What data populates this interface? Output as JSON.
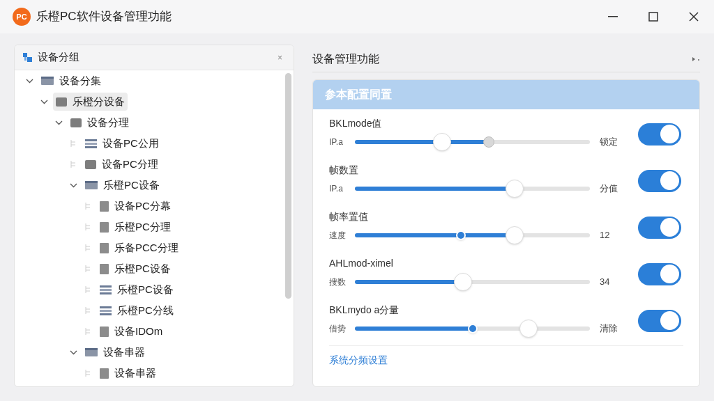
{
  "window": {
    "logo": "PC",
    "title": "乐橙PC软件设备管理功能"
  },
  "sidebar": {
    "title": "设备分组",
    "close": "×",
    "tree": [
      {
        "label": "设备分集",
        "kind": "bar",
        "expanded": true,
        "selected": false,
        "children": [
          {
            "label": "乐橙分设备",
            "kind": "box",
            "expanded": true,
            "selected": true,
            "children": [
              {
                "label": "设备分理",
                "kind": "box",
                "expanded": true,
                "selected": false,
                "children": [
                  {
                    "label": "设备PC公用",
                    "kind": "lines",
                    "selected": false
                  },
                  {
                    "label": "设备PC分理",
                    "kind": "box",
                    "selected": false
                  },
                  {
                    "label": "乐橙PC设备",
                    "kind": "bar",
                    "expanded": true,
                    "selected": false,
                    "children": [
                      {
                        "label": "设备PC分幕",
                        "kind": "book",
                        "selected": false
                      },
                      {
                        "label": "乐橙PC分理",
                        "kind": "book",
                        "selected": false
                      },
                      {
                        "label": "乐备PCC分理",
                        "kind": "book",
                        "selected": false
                      },
                      {
                        "label": "乐橙PC设备",
                        "kind": "book",
                        "selected": false
                      },
                      {
                        "label": "乐橙PC设备",
                        "kind": "lines",
                        "selected": false
                      },
                      {
                        "label": "乐橙PC分线",
                        "kind": "lines",
                        "selected": false
                      },
                      {
                        "label": "设备IDOm",
                        "kind": "book",
                        "selected": false
                      }
                    ]
                  },
                  {
                    "label": "设备串器",
                    "kind": "bar",
                    "expanded": true,
                    "selected": false,
                    "children": [
                      {
                        "label": "设备串器",
                        "kind": "book",
                        "selected": false
                      }
                    ]
                  }
                ]
              }
            ]
          }
        ]
      }
    ]
  },
  "panel": {
    "title": "设备管理功能",
    "section": "参本配置同置",
    "rows": [
      {
        "label": "BKLmode值",
        "sublabel": "IP.a",
        "level": 0.57,
        "handles": [
          {
            "kind": "large",
            "level": 0.37
          },
          {
            "kind": "small",
            "level": 0.57
          }
        ],
        "reading": "锁定",
        "on": true
      },
      {
        "label": "帧数置",
        "sublabel": "IP.a",
        "level": 0.68,
        "handles": [
          {
            "kind": "large",
            "level": 0.68
          }
        ],
        "reading": "分值",
        "on": true
      },
      {
        "label": "帧率置值",
        "sublabel": "速度",
        "level": 0.68,
        "handles": [
          {
            "kind": "dot",
            "level": 0.45
          },
          {
            "kind": "large",
            "level": 0.68
          }
        ],
        "reading": "12",
        "on": true
      },
      {
        "label": "AHLmod-ximel",
        "sublabel": "搜数",
        "level": 0.46,
        "handles": [
          {
            "kind": "large",
            "level": 0.46
          }
        ],
        "reading": "34",
        "on": true
      },
      {
        "label": "BKLmydo a分量",
        "sublabel": "借势",
        "level": 0.5,
        "handles": [
          {
            "kind": "dot",
            "level": 0.5
          },
          {
            "kind": "large",
            "level": 0.74
          }
        ],
        "reading": "清除",
        "on": true
      }
    ],
    "link": "系统分频设置"
  }
}
